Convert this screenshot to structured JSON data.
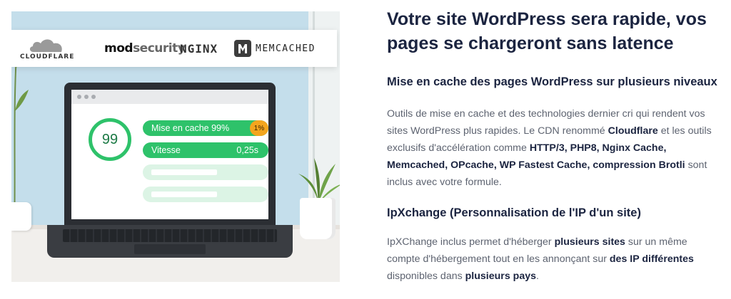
{
  "logos": {
    "cloudflare": "CLOUDFLARE",
    "modsecurity_a": "mod",
    "modsecurity_b": "security",
    "nginx": "NGINX",
    "memcached": "MEMCACHED"
  },
  "dashboard": {
    "score": "99",
    "cache_label": "Mise en cache 99%",
    "cache_badge": "1%",
    "speed_label": "Vitesse",
    "speed_value": "0,25s"
  },
  "heading": "Votre site WordPress sera rapide, vos pages se chargeront sans latence",
  "section1": {
    "title": "Mise en cache des pages WordPress sur plusieurs niveaux",
    "t1": "Outils de mise en cache et des technologies dernier cri qui rendent vos sites WordPress plus rapides. Le CDN renommé ",
    "b1": "Cloudflare",
    "t2": " et les outils exclusifs d'accélération comme ",
    "b2": "HTTP/3, PHP8, Nginx Cache, Memcached, OPcache, WP Fastest Cache, compression Brotli",
    "t3": " sont inclus avec votre formule."
  },
  "section2": {
    "title": "IpXchange (Personnalisation de l'IP d'un site)",
    "t1": "IpXChange inclus permet d'héberger ",
    "b1": "plusieurs sites",
    "t2": " sur un même compte d'hébergement tout en les annonçant sur ",
    "b2": "des IP différentes",
    "t3": " disponibles dans ",
    "b3": "plusieurs pays",
    "t4": "."
  },
  "colors": {
    "accent_green": "#2ec26a",
    "badge_orange": "#f3a51e",
    "heading": "#1b2440",
    "body_text": "#5d6370",
    "wall": "#c4deeb"
  }
}
